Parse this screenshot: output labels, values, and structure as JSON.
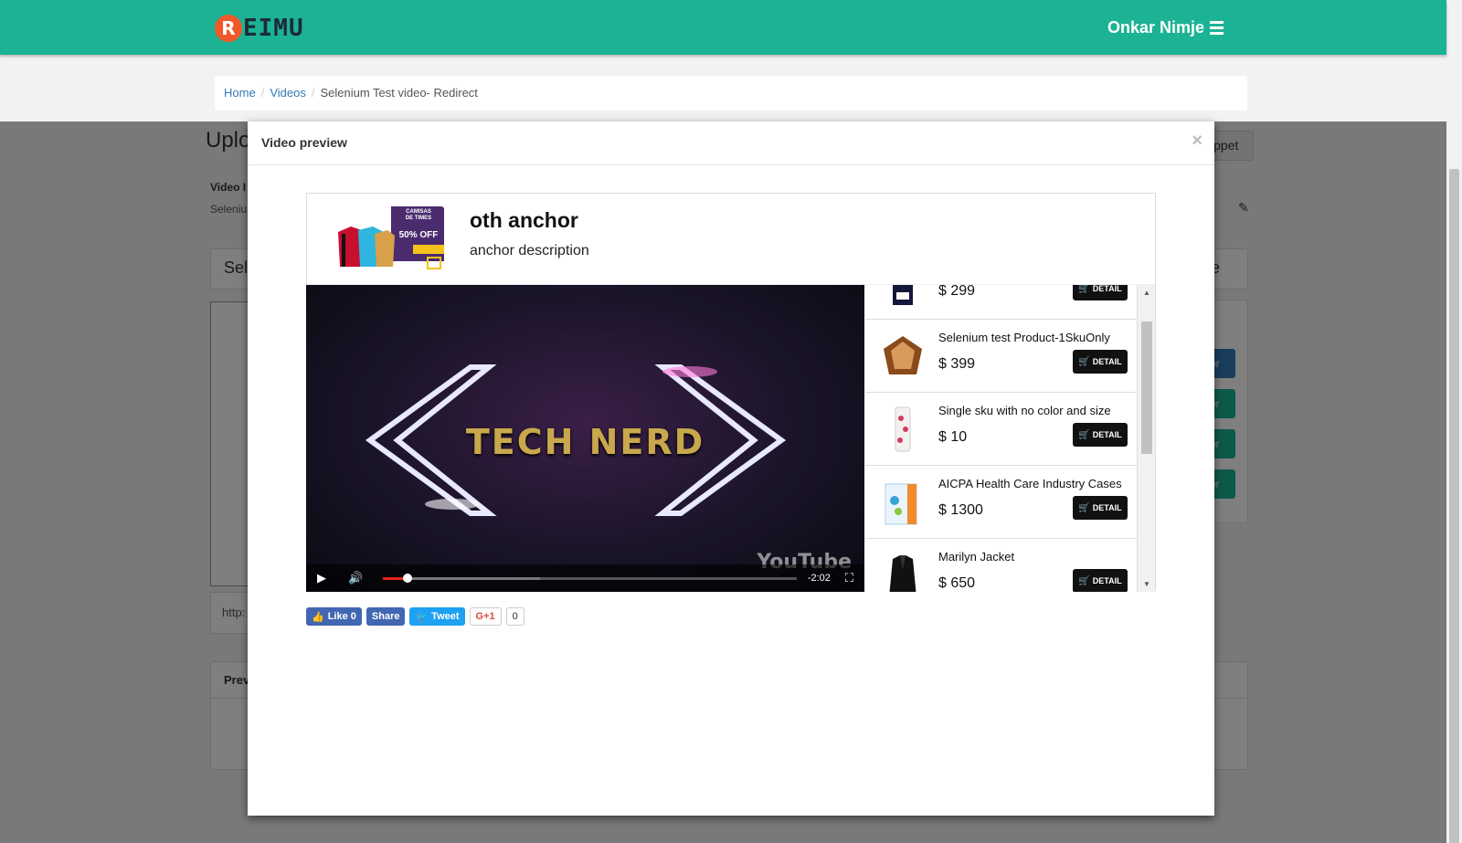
{
  "brand": {
    "logo_letter": "R",
    "logo_text": "EIMU",
    "accent": "#1bb394",
    "logo_color": "#f0592a"
  },
  "nav": {
    "user_name": "Onkar Nimje",
    "menu_icon": "hamburger-icon"
  },
  "breadcrumb": {
    "home": "Home",
    "videos": "Videos",
    "current": "Selenium Test video- Redirect"
  },
  "background": {
    "title": "Uplo",
    "snippet_btn": "ippet",
    "video_label": "Video I",
    "video_sub": "Seleniu",
    "select_text": "Sel",
    "style_text": "yle",
    "url_text": "http:",
    "preview_label": "Prev",
    "btn_text": "or"
  },
  "modal": {
    "title": "Video preview",
    "close": "×",
    "anchor": {
      "thumb_line1": "CAMISAS",
      "thumb_line2": "DE TIMES",
      "thumb_offer": "50% OFF",
      "title": "oth anchor",
      "description": "anchor description"
    },
    "video": {
      "title_text": "TECH NERD",
      "time_remaining": "-2:02",
      "watermark": "YouTube",
      "played_fraction": 0.06,
      "buffered_fraction": 0.38
    },
    "detail_label": "DETAIL",
    "products": [
      {
        "name": "",
        "price": "$ 299"
      },
      {
        "name": "Selenium test Product-1SkuOnly",
        "price": "$ 399"
      },
      {
        "name": "Single sku with no color and size",
        "price": "$ 10"
      },
      {
        "name": "AICPA Health Care Industry Cases",
        "price": "$ 1300"
      },
      {
        "name": "Marilyn Jacket",
        "price": "$ 650"
      }
    ],
    "share": {
      "like": "Like 0",
      "fb_share": "Share",
      "tweet": "Tweet",
      "gplus": "G+1",
      "gplus_count": "0"
    }
  }
}
